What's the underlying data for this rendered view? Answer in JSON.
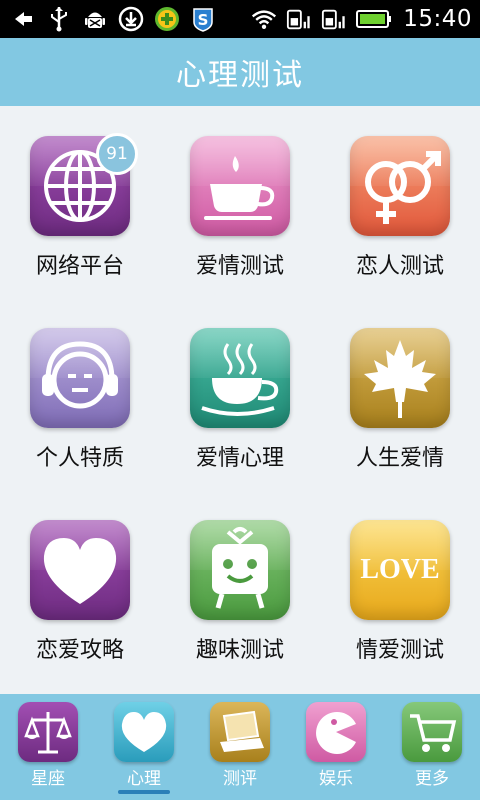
{
  "status_bar": {
    "time": "15:40",
    "icons": [
      "back-arrow-icon",
      "usb-icon",
      "android-debug-icon",
      "download-icon",
      "security-app-icon",
      "s-app-icon",
      "wifi-icon",
      "sim1-signal-icon",
      "sim2-signal-icon",
      "battery-icon"
    ]
  },
  "header": {
    "title": "心理测试"
  },
  "grid": {
    "items": [
      {
        "label": "网络平台",
        "icon": "globe-icon",
        "badge": "91",
        "color": "#8a3b9a"
      },
      {
        "label": "爱情测试",
        "icon": "teacup-icon",
        "color": "#e07cb8"
      },
      {
        "label": "恋人测试",
        "icon": "gender-symbols-icon",
        "color": "#ee7a55"
      },
      {
        "label": "个人特质",
        "icon": "headphones-face-icon",
        "color": "#9a86c6"
      },
      {
        "label": "爱情心理",
        "icon": "coffee-cup-icon",
        "color": "#2fa58e"
      },
      {
        "label": "人生爱情",
        "icon": "maple-leaf-icon",
        "color": "#c59a2a"
      },
      {
        "label": "恋爱攻略",
        "icon": "heart-icon",
        "color": "#8a3b9a"
      },
      {
        "label": "趣味测试",
        "icon": "tv-robot-icon",
        "color": "#62b258"
      },
      {
        "label": "情爱测试",
        "icon": "love-text-icon",
        "text": "LOVE",
        "color": "#f2c02a"
      }
    ]
  },
  "bottom_nav": {
    "items": [
      {
        "label": "星座",
        "icon": "scales-icon",
        "color": "#8a3b9a"
      },
      {
        "label": "心理",
        "icon": "heart-icon",
        "color": "#45b4cf",
        "active": true
      },
      {
        "label": "测评",
        "icon": "laptop-icon",
        "color": "#c59a2a"
      },
      {
        "label": "娱乐",
        "icon": "pacman-icon",
        "color": "#e07cb8"
      },
      {
        "label": "更多",
        "icon": "cart-icon",
        "color": "#62b258"
      }
    ]
  }
}
